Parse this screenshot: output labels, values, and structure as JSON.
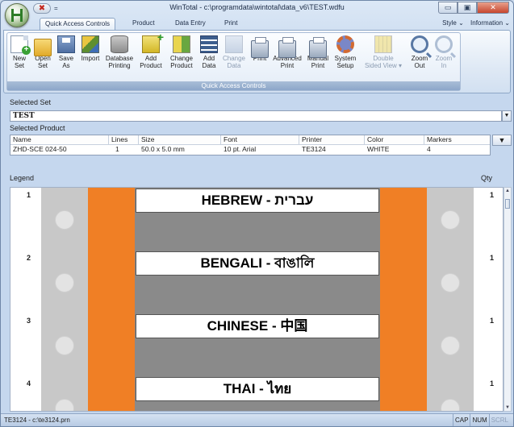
{
  "window": {
    "title": "WinTotal - c:\\programdata\\wintotal\\data_v6\\TEST.wdfu",
    "qat_close": "✖",
    "qat_drop": "=",
    "minimize": "▭",
    "maximize": "▣",
    "close": "✕"
  },
  "tabs": [
    "Quick Access Controls",
    "Product",
    "Data Entry",
    "Print"
  ],
  "tab_right": {
    "style": "Style",
    "information": "Information"
  },
  "ribbon": {
    "group_label": "Quick Access Controls",
    "buttons": [
      {
        "line1": "New",
        "line2": "Set",
        "icon": "new-set-icon",
        "enabled": true
      },
      {
        "line1": "Open",
        "line2": "Set",
        "icon": "open-folder-icon",
        "enabled": true
      },
      {
        "line1": "Save",
        "line2": "As",
        "icon": "save-icon",
        "enabled": true
      },
      {
        "line1": "Import",
        "line2": "",
        "icon": "import-icon",
        "enabled": true
      },
      {
        "line1": "Database",
        "line2": "Printing",
        "icon": "database-icon",
        "enabled": true
      },
      {
        "line1": "Add",
        "line2": "Product",
        "icon": "add-product-icon",
        "enabled": true
      },
      {
        "line1": "Change",
        "line2": "Product",
        "icon": "change-product-icon",
        "enabled": true
      },
      {
        "line1": "Add",
        "line2": "Data",
        "icon": "add-data-icon",
        "enabled": true
      },
      {
        "line1": "Change",
        "line2": "Data",
        "icon": "change-data-icon",
        "enabled": false
      },
      {
        "line1": "Print",
        "line2": "",
        "icon": "print-icon",
        "enabled": true
      },
      {
        "line1": "Advanced",
        "line2": "Print",
        "icon": "advanced-print-icon",
        "enabled": true
      },
      {
        "line1": "Manual",
        "line2": "Print",
        "icon": "manual-print-icon",
        "enabled": true
      },
      {
        "line1": "System",
        "line2": "Setup",
        "icon": "gear-icon",
        "enabled": true
      },
      {
        "line1": "Double",
        "line2": "Sided View ▾",
        "icon": "double-sided-icon",
        "enabled": false
      },
      {
        "line1": "Zoom",
        "line2": "Out",
        "icon": "zoom-out-icon",
        "enabled": true
      },
      {
        "line1": "Zoom",
        "line2": "In",
        "icon": "zoom-in-icon",
        "enabled": false
      }
    ]
  },
  "selected_set": {
    "label": "Selected Set",
    "value": "TEST"
  },
  "selected_product": {
    "label": "Selected Product",
    "columns": [
      "Name",
      "Lines",
      "Size",
      "Font",
      "Printer",
      "Color",
      "Markers"
    ],
    "row": [
      "ZHD-SCE 024-50",
      "1",
      "50.0 x 5.0 mm",
      "10 pt. Arial",
      "TE3124",
      "WHITE",
      "4"
    ],
    "drop_glyph": "▼"
  },
  "legend_label": "Legend",
  "qty_label": "Qty",
  "labels": [
    {
      "index": "1",
      "text": "HEBREW - עברית",
      "qty": "1"
    },
    {
      "index": "2",
      "text": "BENGALI - বাঙালি",
      "qty": "1"
    },
    {
      "index": "3",
      "text": "CHINESE - 中国",
      "qty": "1"
    },
    {
      "index": "4",
      "text": "THAI - ไทย",
      "qty": "1"
    }
  ],
  "status": {
    "left": "TE3124 - c:\\te3124.prn",
    "indicators": [
      "CAP",
      "NUM",
      "SCRL"
    ]
  },
  "colors": {
    "strip_orange": "#f07f25",
    "strip_gray": "#c8c8c8",
    "label_backing": "#8a8a8a"
  }
}
